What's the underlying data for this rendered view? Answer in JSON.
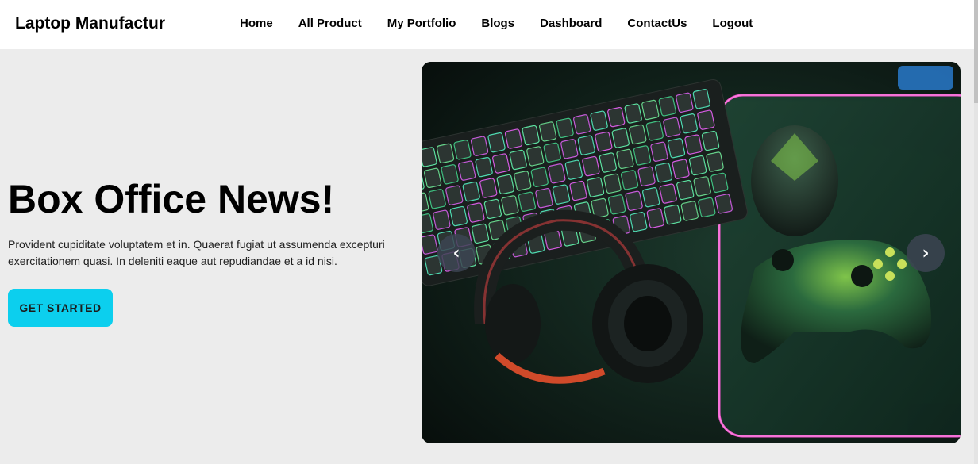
{
  "brand": "Laptop Manufactur",
  "nav": {
    "items": [
      "Home",
      "All Product",
      "My Portfolio",
      "Blogs",
      "Dashboard",
      "ContactUs",
      "Logout"
    ]
  },
  "hero": {
    "title": "Box Office News!",
    "description": "Provident cupiditate voluptatem et in. Quaerat fugiat ut assumenda excepturi exercitationem quasi. In deleniti eaque aut repudiandae et a id nisi.",
    "cta_label": "GET STARTED"
  },
  "carousel": {
    "prev_glyph": "‹",
    "next_glyph": "›",
    "slide_icon": "gaming-setup-image"
  },
  "colors": {
    "accent": "#0ccfee",
    "background": "#ececec",
    "navbar": "#ffffff"
  }
}
